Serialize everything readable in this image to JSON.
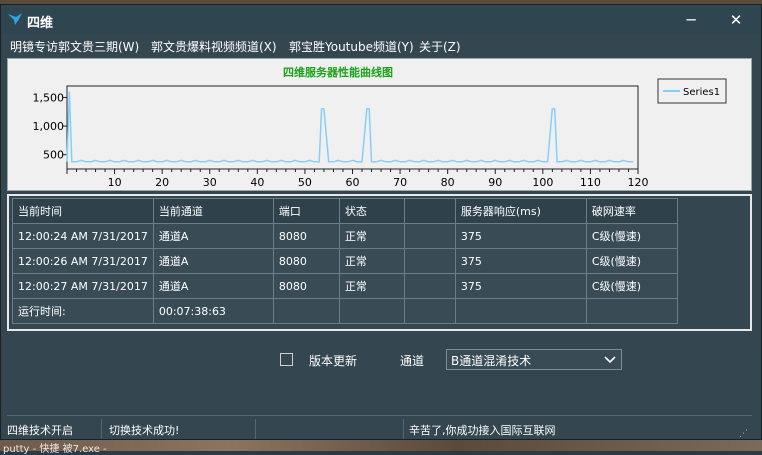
{
  "window": {
    "title": "四维",
    "minimize_glyph": "─",
    "close_glyph": "✕"
  },
  "menu": [
    "明镜专访郭文贵三期(W)",
    "郭文贵爆料视频频道(X)",
    "郭宝胜Youtube频道(Y)",
    "关于(Z)"
  ],
  "chart_data": {
    "type": "line",
    "title": "四维服务器性能曲线图",
    "series": [
      {
        "name": "Series1",
        "color": "#87cefa",
        "x": [
          0,
          0.5,
          1,
          2,
          3,
          4,
          5,
          6,
          7,
          8,
          9,
          10,
          11,
          12,
          13,
          14,
          15,
          16,
          17,
          18,
          19,
          20,
          21,
          22,
          23,
          24,
          25,
          26,
          27,
          28,
          29,
          30,
          31,
          32,
          33,
          34,
          35,
          36,
          37,
          38,
          39,
          40,
          41,
          42,
          43,
          44,
          45,
          46,
          47,
          48,
          49,
          50,
          51,
          52,
          53,
          53.5,
          54,
          55,
          56,
          57,
          58,
          59,
          60,
          61,
          62,
          63,
          63.5,
          64,
          65,
          66,
          67,
          68,
          69,
          70,
          71,
          72,
          73,
          74,
          75,
          76,
          77,
          78,
          79,
          80,
          81,
          82,
          83,
          84,
          85,
          86,
          87,
          88,
          89,
          90,
          91,
          92,
          93,
          94,
          95,
          96,
          97,
          98,
          99,
          100,
          101,
          102,
          102.5,
          103,
          104,
          105,
          106,
          107,
          108,
          109,
          110,
          111,
          112,
          113,
          114,
          115,
          116,
          117,
          118,
          119
        ],
        "values": [
          375,
          1600,
          375,
          375,
          400,
          375,
          375,
          400,
          375,
          375,
          400,
          375,
          375,
          400,
          375,
          375,
          400,
          375,
          375,
          400,
          375,
          375,
          400,
          375,
          375,
          400,
          375,
          375,
          400,
          375,
          375,
          400,
          375,
          375,
          400,
          375,
          375,
          400,
          375,
          375,
          400,
          375,
          375,
          400,
          375,
          375,
          400,
          375,
          375,
          400,
          375,
          375,
          400,
          375,
          375,
          1300,
          1300,
          375,
          375,
          400,
          375,
          375,
          400,
          375,
          375,
          1300,
          1300,
          375,
          375,
          400,
          375,
          375,
          400,
          375,
          375,
          400,
          375,
          375,
          400,
          375,
          375,
          400,
          375,
          375,
          400,
          375,
          375,
          400,
          375,
          375,
          400,
          375,
          375,
          400,
          375,
          375,
          400,
          375,
          375,
          400,
          375,
          375,
          400,
          375,
          375,
          1300,
          1300,
          375,
          375,
          400,
          375,
          375,
          400,
          375,
          375,
          400,
          375,
          375,
          400,
          375,
          375,
          400,
          375,
          375
        ]
      }
    ],
    "x_ticks": [
      10,
      20,
      30,
      40,
      50,
      60,
      70,
      80,
      90,
      100,
      110,
      120
    ],
    "y_ticks": [
      500,
      1000,
      1500
    ],
    "y_tick_labels": [
      "500",
      "1,000",
      "1,500"
    ],
    "xlim": [
      0,
      120
    ],
    "ylim": [
      250,
      1700
    ],
    "legend": "top-right",
    "grid": false
  },
  "table": {
    "headers": [
      "当前时间",
      "当前通道",
      "端口",
      "状态",
      "",
      "服务器响应(ms)",
      "破网速率"
    ],
    "rows": [
      [
        "12:00:24 AM 7/31/2017",
        "通道A",
        "8080",
        "正常",
        "",
        "375",
        "C级(慢速)"
      ],
      [
        "12:00:26 AM 7/31/2017",
        "通道A",
        "8080",
        "正常",
        "",
        "375",
        "C级(慢速)"
      ],
      [
        "12:00:27 AM 7/31/2017",
        "通道A",
        "8080",
        "正常",
        "",
        "375",
        "C级(慢速)"
      ]
    ],
    "runtime_label": "运行时间:",
    "runtime_value": "00:07:38:63"
  },
  "controls": {
    "version_update": "版本更新",
    "version_checked": false,
    "channel_label": "通道",
    "channel_value": "B通道混淆技术"
  },
  "status": [
    "四维技术开启",
    "切换技术成功!",
    "辛苦了,你成功接入国际互联网"
  ],
  "desktop_taskbar_text": "putty - 快捷    被7.exe -"
}
